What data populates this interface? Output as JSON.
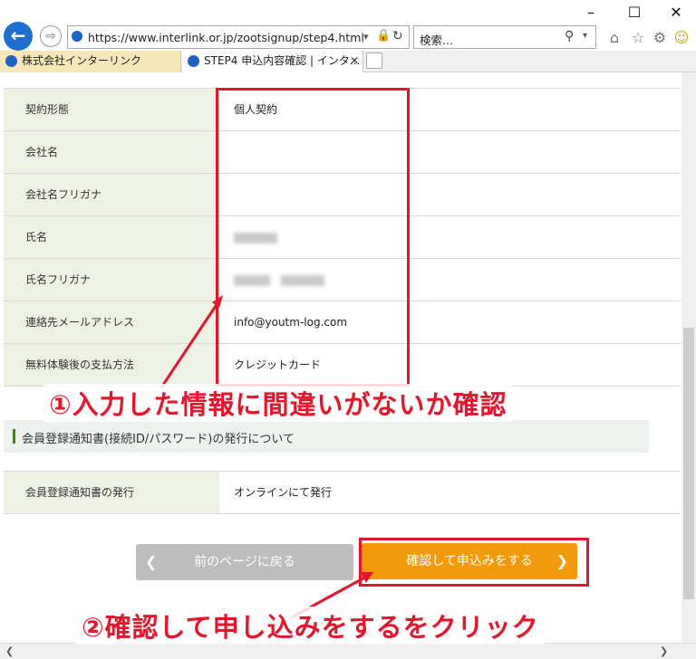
{
  "browser": {
    "url": "https://www.interlink.or.jp/zootsignup/step4.html",
    "search_placeholder": "検索...",
    "tabs": [
      {
        "label": "株式会社インターリンク"
      },
      {
        "label": "STEP4 申込内容確認 | インタ..."
      }
    ],
    "window_controls": {
      "minimize": "–",
      "maximize": "☐",
      "close": "✕"
    }
  },
  "form": {
    "rows": [
      {
        "label": "契約形態",
        "value": "個人契約"
      },
      {
        "label": "会社名",
        "value": ""
      },
      {
        "label": "会社名フリガナ",
        "value": ""
      },
      {
        "label": "氏名",
        "value": ""
      },
      {
        "label": "氏名フリガナ",
        "value": ""
      },
      {
        "label": "連絡先メールアドレス",
        "value": "info@youtm-log.com"
      },
      {
        "label": "無料体験後の支払方法",
        "value": "クレジットカード"
      }
    ],
    "section_title": "会員登録通知書(接続ID/パスワード)の発行について",
    "issue_row": {
      "label": "会員登録通知書の発行",
      "value": "オンラインにて発行"
    }
  },
  "buttons": {
    "back": {
      "label": "前のページに戻る",
      "icon": "❮"
    },
    "confirm": {
      "label": "確認して申込みをする",
      "icon": "❯"
    }
  },
  "annotations": {
    "note1": "①入力した情報に間違いがないか確認",
    "note2": "②確認して申し込みをするをクリック"
  },
  "colors": {
    "accent_orange": "#f29a0b",
    "annotation_red": "#e8142c",
    "label_bg": "#eef2e4",
    "back_btn": "#bdbdbd"
  }
}
